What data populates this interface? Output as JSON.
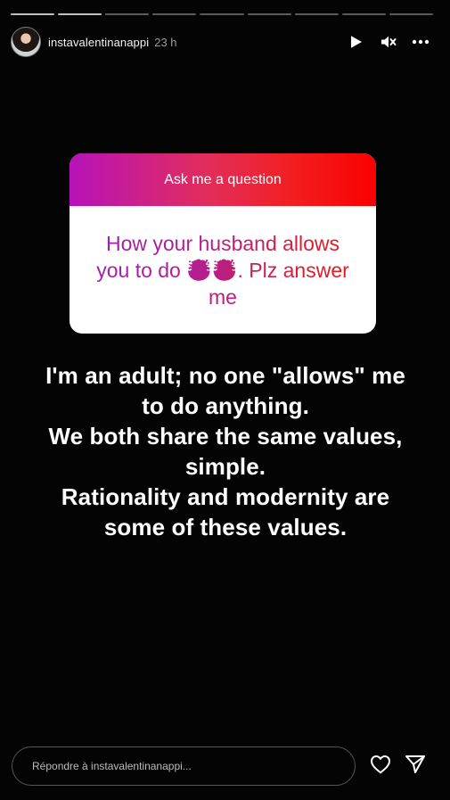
{
  "story": {
    "progress_segments": 9,
    "progress_completed": 2,
    "user": {
      "username": "instavalentinanappi",
      "time": "23 h"
    },
    "controls": {
      "play_icon": "play-icon",
      "mute_icon": "mute-icon",
      "more_icon": "more-icon"
    },
    "question_sticker": {
      "title": "Ask me a question",
      "question": "How your husband allows you to do 🤯🤯.   Plz answer me"
    },
    "answer_lines": [
      "I'm an adult; no one \"allows\" me",
      "to do anything.",
      "We both share the same values,",
      "simple.",
      "Rationality and modernity are",
      "some of these values."
    ],
    "reply": {
      "placeholder": "Répondre à instavalentinanappi..."
    },
    "colors": {
      "background": "#040404",
      "sticker_gradient_start": "#b712b9",
      "sticker_gradient_end": "#fb0000",
      "text": "#ffffff"
    }
  }
}
